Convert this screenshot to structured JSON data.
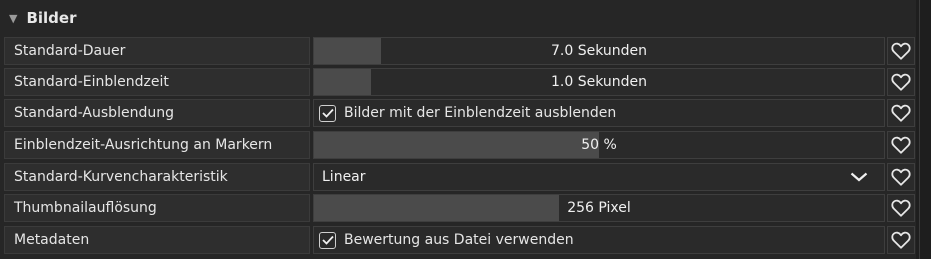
{
  "section": {
    "title": "Bilder",
    "icon": "triangle-down-icon"
  },
  "rows": [
    {
      "label": "Standard-Dauer",
      "type": "slider",
      "value": "7.0 Sekunden",
      "fill_fraction": 0.117
    },
    {
      "label": "Standard-Einblendzeit",
      "type": "slider",
      "value": "1.0 Sekunden",
      "fill_fraction": 0.1
    },
    {
      "label": "Standard-Ausblendung",
      "type": "checkbox",
      "checked": true,
      "text": "Bilder mit der Einblendzeit ausblenden"
    },
    {
      "label": "Einblendzeit-Ausrichtung an Markern",
      "type": "slider",
      "value": "50 %",
      "fill_fraction": 0.5
    },
    {
      "label": "Standard-Kurvencharakteristik",
      "type": "dropdown",
      "value": "Linear",
      "icon": "chevron-down-icon"
    },
    {
      "label": "Thumbnailauflösung",
      "type": "slider",
      "value": "256 Pixel",
      "fill_fraction": 0.43
    },
    {
      "label": "Metadaten",
      "type": "checkbox",
      "checked": true,
      "text": "Bewertung aus Datei verwenden"
    }
  ],
  "favorite_icon": "heart-outline-icon",
  "colors": {
    "panel": "#262626",
    "slider_fill": "#4b4b4b",
    "control_bg": "#2a2a2a",
    "border": "#3e3e3e"
  }
}
